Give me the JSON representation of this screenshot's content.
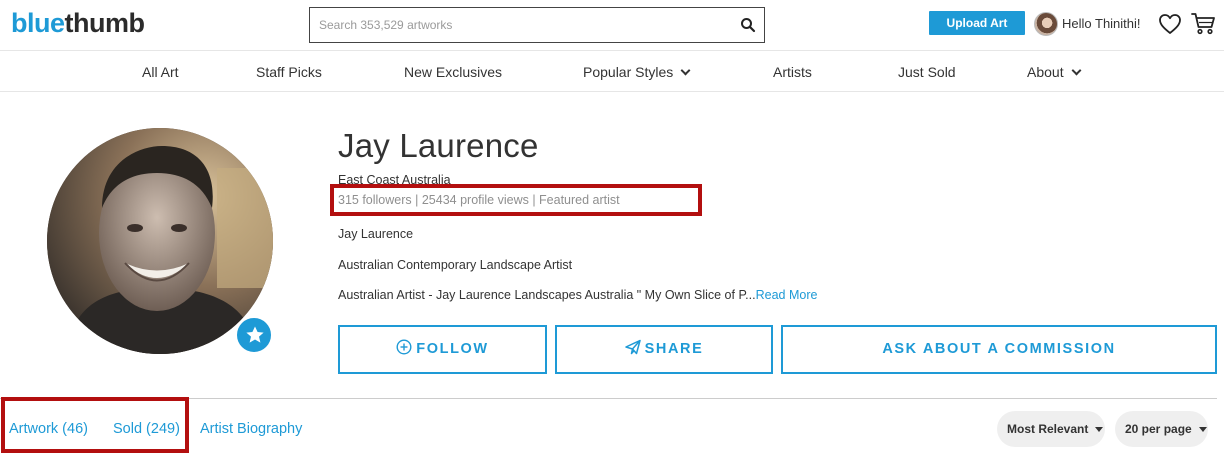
{
  "header": {
    "logo_part1": "blue",
    "logo_part2": "thumb",
    "search_placeholder": "Search 353,529 artworks",
    "upload_label": "Upload Art",
    "greeting": "Hello Thinithi!"
  },
  "nav": {
    "items": [
      "All Art",
      "Staff Picks",
      "New Exclusives",
      "Popular Styles",
      "Artists",
      "Just Sold",
      "About"
    ]
  },
  "profile": {
    "name": "Jay Laurence",
    "location": "East Coast Australia",
    "stats": "315 followers | 25434 profile views | Featured artist",
    "line1": "Jay Laurence",
    "line2": "Australian Contemporary Landscape Artist",
    "bio_snippet": "Australian Artist - Jay Laurence Landscapes Australia \" My Own Slice of P...",
    "read_more": "Read More"
  },
  "actions": {
    "follow": "FOLLOW",
    "share": "SHARE",
    "commission": "ASK ABOUT A COMMISSION"
  },
  "tabs": {
    "artwork": "Artwork (46)",
    "sold": "Sold (249)",
    "biography": "Artist Biography"
  },
  "sorting": {
    "sort_selected": "Most Relevant",
    "per_page_selected": "20 per page"
  },
  "colors": {
    "accent": "#1e9ad6",
    "highlight_box": "#b30f0f"
  }
}
